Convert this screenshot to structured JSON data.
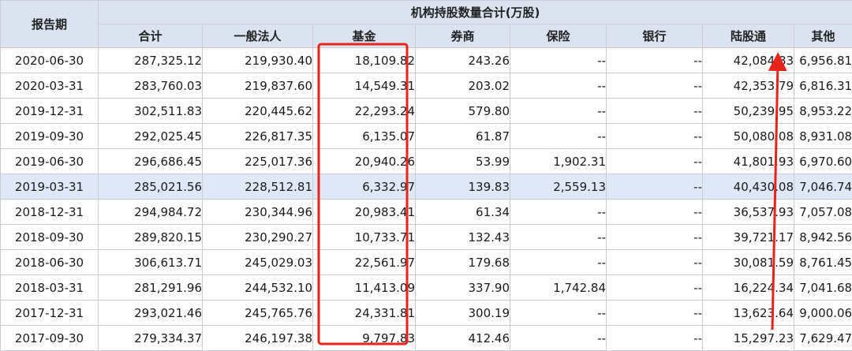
{
  "header": {
    "report_period": "报告期",
    "group_title": "机构持股数量合计(万股)",
    "columns": [
      "合计",
      "一般法人",
      "基金",
      "券商",
      "保险",
      "银行",
      "陆股通",
      "其他"
    ]
  },
  "rows": [
    {
      "date": "2020-06-30",
      "total": "287,325.12",
      "corp": "219,930.40",
      "fund": "18,109.82",
      "broker": "243.26",
      "insurance": "--",
      "bank": "--",
      "connect": "42,084.83",
      "other": "6,956.81"
    },
    {
      "date": "2020-03-31",
      "total": "283,760.03",
      "corp": "219,837.60",
      "fund": "14,549.31",
      "broker": "203.02",
      "insurance": "--",
      "bank": "--",
      "connect": "42,353.79",
      "other": "6,816.31"
    },
    {
      "date": "2019-12-31",
      "total": "302,511.83",
      "corp": "220,445.62",
      "fund": "22,293.24",
      "broker": "579.80",
      "insurance": "--",
      "bank": "--",
      "connect": "50,239.95",
      "other": "8,953.22"
    },
    {
      "date": "2019-09-30",
      "total": "292,025.45",
      "corp": "226,817.35",
      "fund": "6,135.07",
      "broker": "61.87",
      "insurance": "--",
      "bank": "--",
      "connect": "50,080.08",
      "other": "8,931.08"
    },
    {
      "date": "2019-06-30",
      "total": "296,686.45",
      "corp": "225,017.36",
      "fund": "20,940.26",
      "broker": "53.99",
      "insurance": "1,902.31",
      "bank": "--",
      "connect": "41,801.93",
      "other": "6,970.60"
    },
    {
      "date": "2019-03-31",
      "total": "285,021.56",
      "corp": "228,512.81",
      "fund": "6,332.97",
      "broker": "139.83",
      "insurance": "2,559.13",
      "bank": "--",
      "connect": "40,430.08",
      "other": "7,046.74"
    },
    {
      "date": "2018-12-31",
      "total": "294,984.72",
      "corp": "230,344.96",
      "fund": "20,983.41",
      "broker": "61.34",
      "insurance": "--",
      "bank": "--",
      "connect": "36,537.93",
      "other": "7,057.08"
    },
    {
      "date": "2018-09-30",
      "total": "289,820.15",
      "corp": "230,290.27",
      "fund": "10,733.71",
      "broker": "132.43",
      "insurance": "--",
      "bank": "--",
      "connect": "39,721.17",
      "other": "8,942.56"
    },
    {
      "date": "2018-06-30",
      "total": "306,613.71",
      "corp": "245,029.03",
      "fund": "22,561.97",
      "broker": "179.68",
      "insurance": "--",
      "bank": "--",
      "connect": "30,081.59",
      "other": "8,761.45"
    },
    {
      "date": "2018-03-31",
      "total": "281,291.96",
      "corp": "244,532.10",
      "fund": "11,413.09",
      "broker": "337.90",
      "insurance": "1,742.84",
      "bank": "--",
      "connect": "16,224.34",
      "other": "7,041.68"
    },
    {
      "date": "2017-12-31",
      "total": "293,021.46",
      "corp": "245,765.76",
      "fund": "24,331.81",
      "broker": "300.19",
      "insurance": "--",
      "bank": "--",
      "connect": "13,623.64",
      "other": "9,000.06"
    },
    {
      "date": "2017-09-30",
      "total": "279,334.37",
      "corp": "246,197.38",
      "fund": "9,797.83",
      "broker": "412.46",
      "insurance": "--",
      "bank": "--",
      "connect": "15,297.23",
      "other": "7,629.47"
    }
  ],
  "colors": {
    "header_bg": "#dbe3f1",
    "row_highlight": "#dfe8f7",
    "grid": "#c9cdd4",
    "annotation": "#e8231a"
  }
}
